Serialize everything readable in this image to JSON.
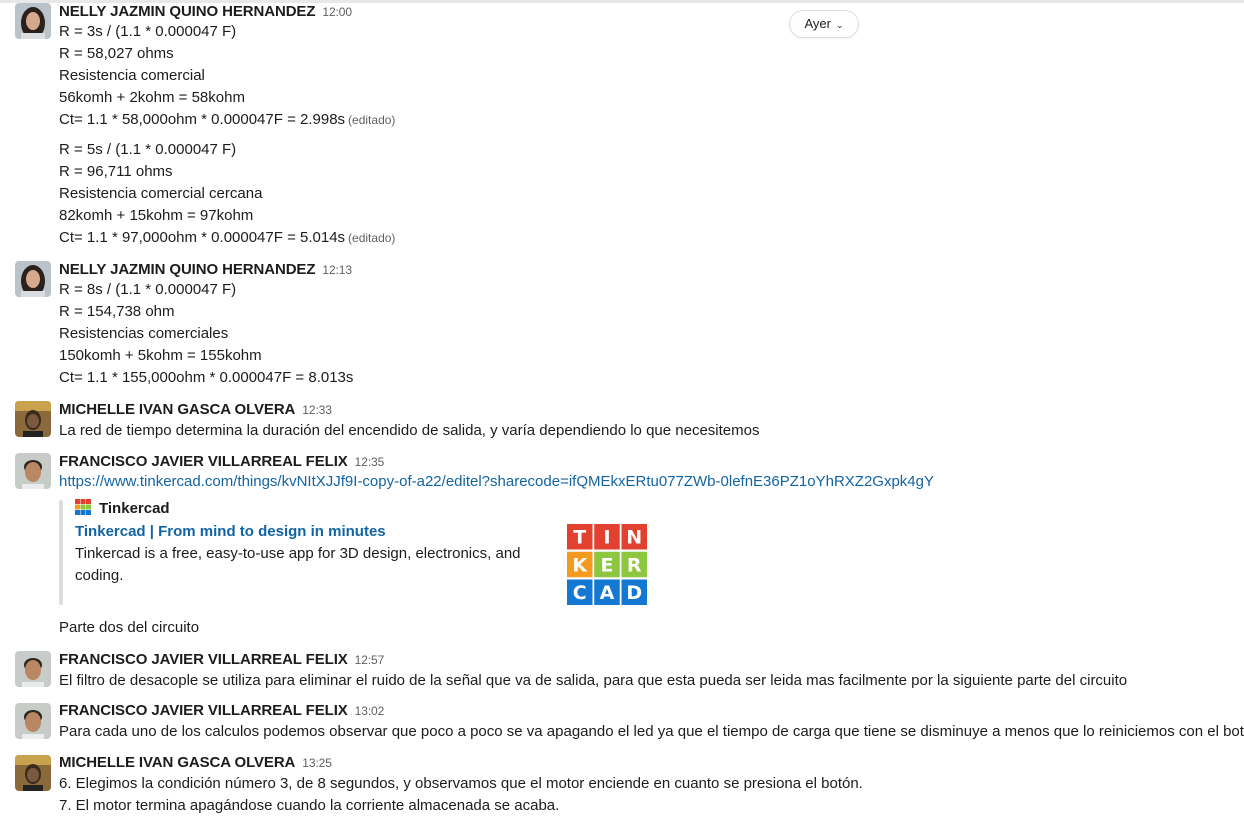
{
  "day_divider": {
    "label": "Ayer",
    "icon": "chevron-down-icon"
  },
  "messages": [
    {
      "author": "NELLY JAZMIN QUINO HERNANDEZ",
      "time": "12:00",
      "lines": [
        "R = 3s / (1.1 * 0.000047 F)",
        "R = 58,027 ohms",
        "Resistencia comercial",
        "56komh + 2kohm = 58kohm",
        "Ct= 1.1 * 58,000ohm * 0.000047F = 2.998s"
      ],
      "edited": "(editado)"
    },
    {
      "lines": [
        "R = 5s / (1.1 * 0.000047 F)",
        "R = 96,711 ohms",
        "Resistencia comercial cercana",
        "82komh + 15kohm = 97kohm",
        "Ct= 1.1 * 97,000ohm * 0.000047F = 5.014s"
      ],
      "edited": "(editado)"
    },
    {
      "author": "NELLY JAZMIN QUINO HERNANDEZ",
      "time": "12:13",
      "lines": [
        "R = 8s / (1.1 * 0.000047 F)",
        "R = 154,738 ohm",
        "Resistencias comerciales",
        "150komh + 5kohm = 155kohm",
        "Ct= 1.1 * 155,000ohm * 0.000047F = 8.013s"
      ]
    },
    {
      "author": "MICHELLE IVAN GASCA OLVERA",
      "time": "12:33",
      "lines": [
        "La red de tiempo determina la duración del encendido de salida, y varía dependiendo lo que necesitemos"
      ]
    },
    {
      "author": "FRANCISCO JAVIER VILLARREAL FELIX",
      "time": "12:35",
      "link": "https://www.tinkercad.com/things/kvNItXJJf9I-copy-of-a22/editel?sharecode=ifQMEkxERtu077ZWb-0lefnE36PZ1oYhRXZ2Gxpk4gY",
      "unfurl": {
        "site": "Tinkercad",
        "title": "Tinkercad | From mind to design in minutes",
        "description": "Tinkercad is a free, easy-to-use app for 3D design, electronics, and coding.",
        "logo_letters": [
          "T",
          "I",
          "N",
          "K",
          "E",
          "R",
          "C",
          "A",
          "D"
        ]
      },
      "after": "Parte dos del circuito"
    },
    {
      "author": "FRANCISCO JAVIER VILLARREAL FELIX",
      "time": "12:57",
      "lines": [
        "El filtro de desacople se utiliza para eliminar el ruido de la señal que va de salida, para que esta pueda ser leida mas facilmente por la siguiente parte del circuito"
      ]
    },
    {
      "author": "FRANCISCO JAVIER VILLARREAL FELIX",
      "time": "13:02",
      "lines": [
        "Para cada uno de los calculos podemos observar que poco a poco se va apagando el led ya que el tiempo de carga que tiene se disminuye a menos que lo reiniciemos con el boton"
      ]
    },
    {
      "author": "MICHELLE IVAN GASCA OLVERA",
      "time": "13:25",
      "lines": [
        "6. Elegimos la condición número 3, de 8 segundos, y observamos que el motor enciende en cuanto se presiona el botón.",
        "7.  El motor termina apagándose cuando la corriente almacenada se acaba."
      ]
    }
  ],
  "colors": {
    "text": "#1d1c1d",
    "muted": "#616061",
    "link": "#1264a3",
    "tk_red": "#e2412f",
    "tk_orange": "#f39a1f",
    "tk_green": "#8dc63f",
    "tk_blue": "#1477d1"
  }
}
